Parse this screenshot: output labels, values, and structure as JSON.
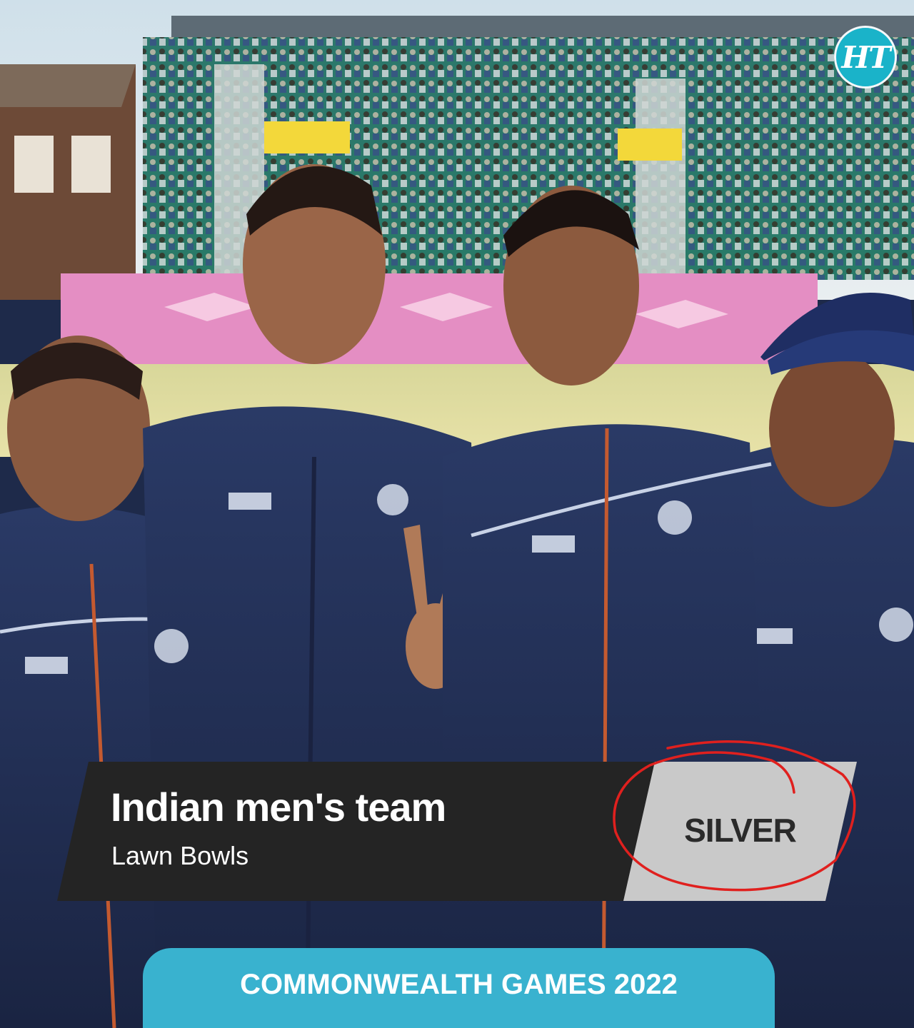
{
  "logo": {
    "text": "HT",
    "icon": "ht-logo-icon",
    "color": "#1ab3c9"
  },
  "caption": {
    "title": "Indian men's team",
    "subtitle": "Lawn Bowls",
    "medal": "SILVER"
  },
  "banner": {
    "text": "COMMONWEALTH GAMES 2022",
    "color": "#39b2cf"
  },
  "colors": {
    "caption_bg": "#242424",
    "medal_bg": "#c9c9c9",
    "circle_annotation": "#e0201e",
    "jacket": "#1e2a4a"
  }
}
